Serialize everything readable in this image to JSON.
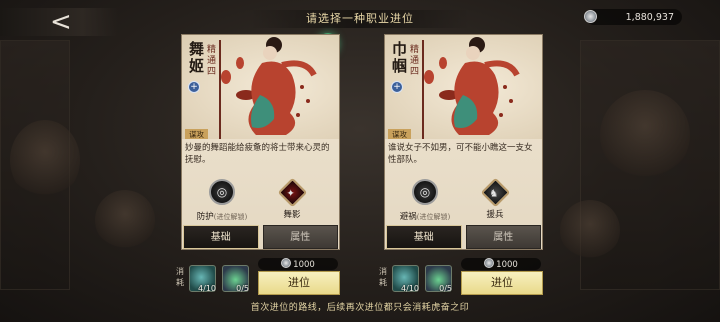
{
  "header": {
    "back_glyph": "<",
    "title": "请选择一种职业进位",
    "currency_value": "1,880,937",
    "currency_icon": "silver-coin-icon"
  },
  "seal_glyph": "蓉",
  "cards": [
    {
      "name_chars": [
        "舞",
        "姬"
      ],
      "rank_chars": [
        "精",
        "通",
        "四"
      ],
      "tag": "谋攻",
      "description": "妙曼的舞蹈能给疲惫的将士带来心灵的抚慰。",
      "skill_1": {
        "name": "防护",
        "note": "(进位解锁)"
      },
      "skill_2": {
        "name": "舞影"
      },
      "tab_basic": "基础",
      "tab_attr": "属性",
      "cost_label": [
        "消",
        "耗"
      ],
      "item_1_count": "4/10",
      "item_2_count": "0/5",
      "price": "1000",
      "advance_label": "进位"
    },
    {
      "name_chars": [
        "巾",
        "帼"
      ],
      "rank_chars": [
        "精",
        "通",
        "四"
      ],
      "tag": "谋攻",
      "description": "谁说女子不如男，可不能小瞧这一支女性部队。",
      "skill_1": {
        "name": "避祸",
        "note": "(进位解锁)"
      },
      "skill_2": {
        "name": "援兵"
      },
      "tab_basic": "基础",
      "tab_attr": "属性",
      "cost_label": [
        "消",
        "耗"
      ],
      "item_1_count": "4/10",
      "item_2_count": "0/5",
      "price": "1000",
      "advance_label": "进位"
    }
  ],
  "footer_note": "首次进位的路线，后续再次进位都只会消耗虎奋之印",
  "colors": {
    "accent_gold": "#e9d98a",
    "card_bg": "#efe5d2",
    "dress_red": "#b8432f"
  }
}
